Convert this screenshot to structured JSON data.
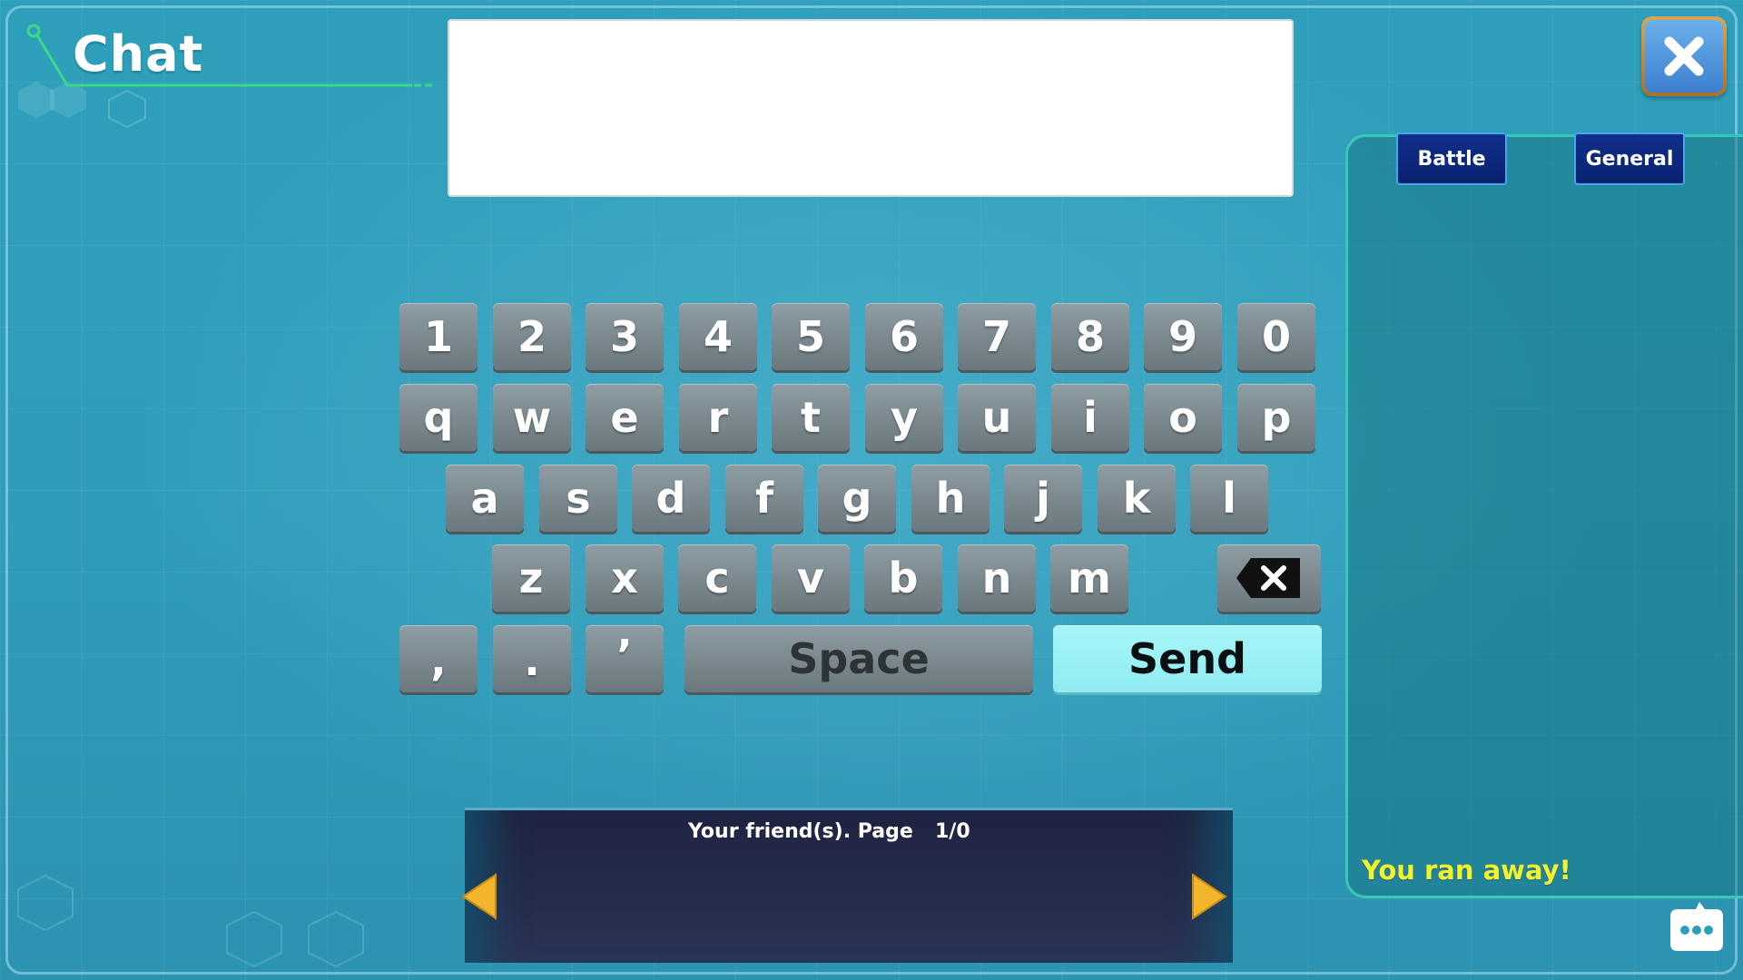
{
  "header": {
    "title": "Chat"
  },
  "input": {
    "value": ""
  },
  "keyboard": {
    "row1": [
      "1",
      "2",
      "3",
      "4",
      "5",
      "6",
      "7",
      "8",
      "9",
      "0"
    ],
    "row2": [
      "q",
      "w",
      "e",
      "r",
      "t",
      "y",
      "u",
      "i",
      "o",
      "p"
    ],
    "row3": [
      "a",
      "s",
      "d",
      "f",
      "g",
      "h",
      "j",
      "k",
      "l"
    ],
    "row4": [
      "z",
      "x",
      "c",
      "v",
      "b",
      "n",
      "m"
    ],
    "punctuation": [
      ",",
      ".",
      "’"
    ],
    "space_label": "Space",
    "send_label": "Send",
    "backspace_icon": "backspace-icon"
  },
  "friends": {
    "label": "Your friend(s). Page",
    "page": "1/0",
    "prev_icon": "arrow-left-icon",
    "next_icon": "arrow-right-icon"
  },
  "log": {
    "tabs": [
      {
        "label": "Battle"
      },
      {
        "label": "General"
      }
    ],
    "messages": [
      {
        "text": "You ran away!"
      }
    ]
  },
  "controls": {
    "close_icon": "close-icon",
    "chat_icon": "chat-bubble-icon"
  },
  "colors": {
    "background": "#2e9fbb",
    "send_button": "#9af0f4",
    "tab": "#0f2f8a",
    "log_message": "#f4f22d",
    "panel_border": "#37c8b8"
  }
}
